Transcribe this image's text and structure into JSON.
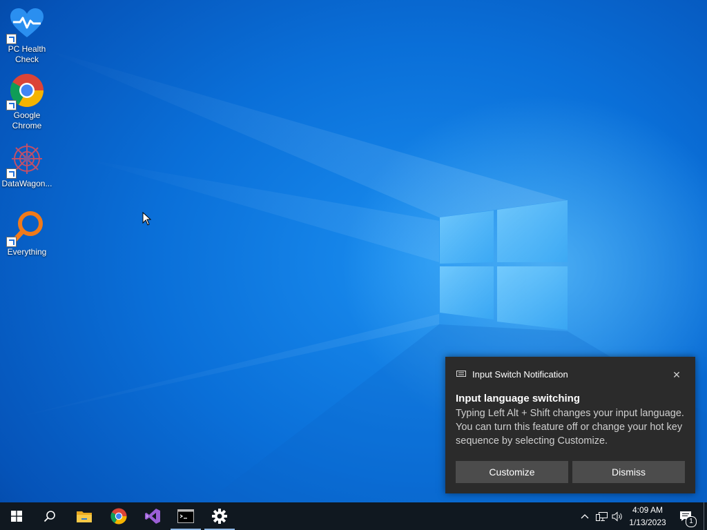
{
  "desktop": {
    "icons": [
      {
        "label_line1": "PC Health",
        "label_line2": "Check",
        "icon": "pc-health-check-icon"
      },
      {
        "label_line1": "Google",
        "label_line2": "Chrome",
        "icon": "google-chrome-icon"
      },
      {
        "label_line1": "DataWagon...",
        "icon": "datawagon-icon"
      },
      {
        "label_line1": "Everything",
        "icon": "everything-search-icon"
      }
    ]
  },
  "notification": {
    "app_name": "Input Switch Notification",
    "title": "Input language switching",
    "body": "Typing Left Alt + Shift changes your input language. You can turn this feature off or change your hot key sequence by selecting Customize.",
    "customize_label": "Customize",
    "dismiss_label": "Dismiss",
    "close_glyph": "✕"
  },
  "taskbar": {
    "items": [
      "start-icon",
      "search-icon",
      "file-explorer-icon",
      "google-chrome-icon",
      "visual-studio-icon",
      "command-prompt-icon",
      "settings-icon"
    ],
    "clock_time": "4:09 AM",
    "clock_date": "1/13/2023",
    "notification_count": "1"
  },
  "colors": {
    "taskbar": "#101820",
    "toast_bg": "#2b2b2b",
    "toast_button": "#4c4c4c",
    "desktop_accent": "#0a6fd8"
  }
}
